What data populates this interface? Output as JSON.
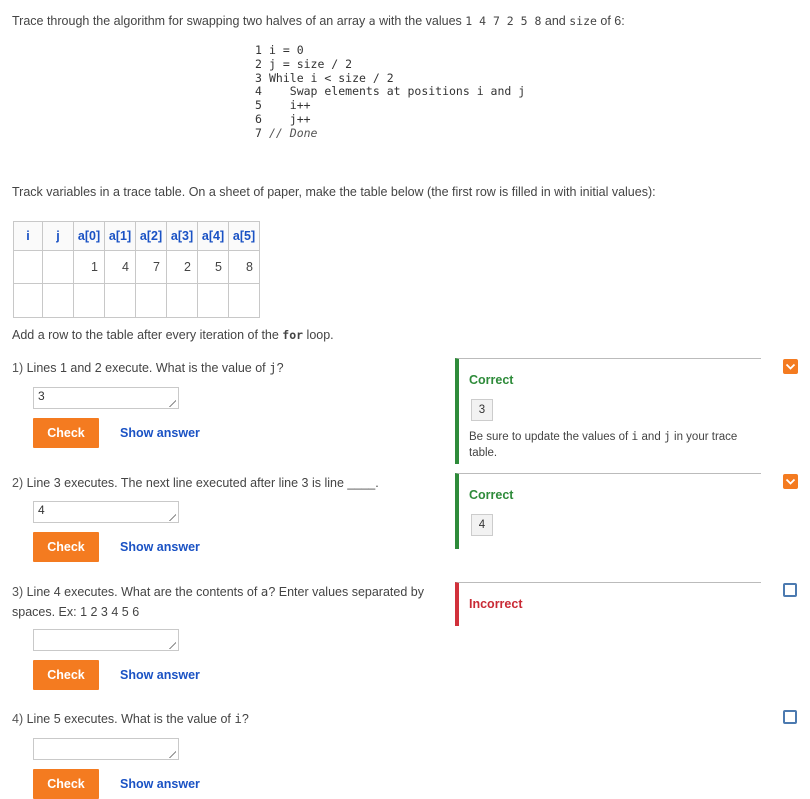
{
  "intro": {
    "part1": "Trace through the algorithm for swapping two halves of an array ",
    "arr_name": "a",
    "part2": " with the values ",
    "values": "1 4 7 2 5 8",
    "part3": " and ",
    "size_name": "size",
    "part4": " of 6:"
  },
  "code": {
    "lines": [
      {
        "n": "1",
        "text": "i = 0"
      },
      {
        "n": "2",
        "text": "j = size / 2"
      },
      {
        "n": "3",
        "text": "While i < size / 2"
      },
      {
        "n": "4",
        "text": "   Swap elements at positions i and j"
      },
      {
        "n": "5",
        "text": "   i++"
      },
      {
        "n": "6",
        "text": "   j++"
      },
      {
        "n": "7",
        "text": "// Done"
      }
    ]
  },
  "track_text": "Track variables in a trace table. On a sheet of paper, make the table below (the first row is filled in with initial values):",
  "trace_table": {
    "headers": [
      "i",
      "j",
      "a[0]",
      "a[1]",
      "a[2]",
      "a[3]",
      "a[4]",
      "a[5]"
    ],
    "row1": [
      "",
      "",
      "1",
      "4",
      "7",
      "2",
      "5",
      "8"
    ]
  },
  "add_row": {
    "part1": "Add a row to the table after every iteration of the ",
    "kw": "for",
    "part2": " loop."
  },
  "questions": {
    "q1": {
      "num": "1)",
      "text": "Lines 1 and 2 execute. What is the value of ",
      "var": "j",
      "end": "?",
      "answer": "3"
    },
    "q2": {
      "num": "2)",
      "text": "Line 3 executes. The next line executed after line 3 is line ____.",
      "answer": "4"
    },
    "q3": {
      "num": "3)",
      "text1": "Line 4 executes. What are the contents of ",
      "var": "a",
      "text2": "? Enter values separated by spaces. Ex: 1 2 3 4 5 6",
      "answer": ""
    },
    "q4": {
      "num": "4)",
      "text": "Line 5 executes. What is the value of ",
      "var": "i",
      "end": "?",
      "answer": ""
    }
  },
  "buttons": {
    "check": "Check",
    "show_answer": "Show answer"
  },
  "feedback": {
    "f1": {
      "status": "Correct",
      "value": "3",
      "msg1": "Be sure to update the values of ",
      "v1": "i",
      "msg2": " and ",
      "v2": "j",
      "msg3": " in your trace table."
    },
    "f2": {
      "status": "Correct",
      "value": "4"
    },
    "f3": {
      "status": "Incorrect"
    }
  },
  "colors": {
    "accent": "#f47b20",
    "link": "#1a52c4",
    "correct": "#2e8b3a",
    "incorrect": "#d1313b"
  }
}
